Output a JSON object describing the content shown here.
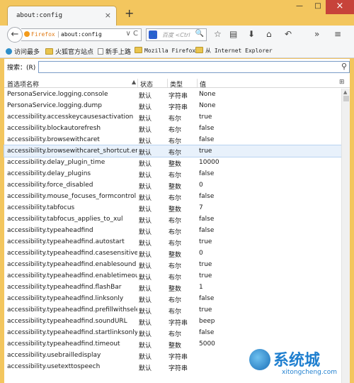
{
  "tab": {
    "title": "about:config",
    "close": "×"
  },
  "newtab": "+",
  "window": {
    "minimize": "—",
    "maximize": "□",
    "close": "×"
  },
  "nav": {
    "identity": "Firefox",
    "url": "about:config",
    "search_placeholder": "百度 <Ctrl",
    "search_engine_glyph": "",
    "url_buttons": "∨ C",
    "search_go": "🔍",
    "icons": {
      "bookmark": "☆",
      "bookmarks_menu": "▤",
      "downloads": "⬇",
      "home": "⌂",
      "reader": "↶",
      "overflow": "»",
      "menu": "≡"
    }
  },
  "bookmarks": [
    {
      "label": "访问最多",
      "icon": "gear"
    },
    {
      "label": "火狐官方站点",
      "icon": "folder"
    },
    {
      "label": "新手上路",
      "icon": "page"
    },
    {
      "label": "Mozilla Firefox",
      "icon": "folder"
    },
    {
      "label": "从 Internet Explorer",
      "icon": "folder"
    }
  ],
  "filter": {
    "label": "搜索：(R)",
    "value": ""
  },
  "columns": {
    "name": "首选项名称",
    "status": "状态",
    "type": "类型",
    "value": "值"
  },
  "column_picker_glyph": "⊞",
  "rows": [
    {
      "name": "PersonaService.logging.console",
      "status": "默认",
      "type": "字符串",
      "value": "None"
    },
    {
      "name": "PersonaService.logging.dump",
      "status": "默认",
      "type": "字符串",
      "value": "None"
    },
    {
      "name": "accessibility.accesskeycausesactivation",
      "status": "默认",
      "type": "布尔",
      "value": "true"
    },
    {
      "name": "accessibility.blockautorefresh",
      "status": "默认",
      "type": "布尔",
      "value": "false"
    },
    {
      "name": "accessibility.browsewithcaret",
      "status": "默认",
      "type": "布尔",
      "value": "false"
    },
    {
      "name": "accessibility.browsewithcaret_shortcut.en...",
      "status": "默认",
      "type": "布尔",
      "value": "true",
      "selected": true
    },
    {
      "name": "accessibility.delay_plugin_time",
      "status": "默认",
      "type": "整数",
      "value": "10000"
    },
    {
      "name": "accessibility.delay_plugins",
      "status": "默认",
      "type": "布尔",
      "value": "false"
    },
    {
      "name": "accessibility.force_disabled",
      "status": "默认",
      "type": "整数",
      "value": "0"
    },
    {
      "name": "accessibility.mouse_focuses_formcontrol",
      "status": "默认",
      "type": "布尔",
      "value": "false"
    },
    {
      "name": "accessibility.tabfocus",
      "status": "默认",
      "type": "整数",
      "value": "7"
    },
    {
      "name": "accessibility.tabfocus_applies_to_xul",
      "status": "默认",
      "type": "布尔",
      "value": "false"
    },
    {
      "name": "accessibility.typeaheadfind",
      "status": "默认",
      "type": "布尔",
      "value": "false"
    },
    {
      "name": "accessibility.typeaheadfind.autostart",
      "status": "默认",
      "type": "布尔",
      "value": "true"
    },
    {
      "name": "accessibility.typeaheadfind.casesensitive",
      "status": "默认",
      "type": "整数",
      "value": "0"
    },
    {
      "name": "accessibility.typeaheadfind.enablesound",
      "status": "默认",
      "type": "布尔",
      "value": "true"
    },
    {
      "name": "accessibility.typeaheadfind.enabletimeout",
      "status": "默认",
      "type": "布尔",
      "value": "true"
    },
    {
      "name": "accessibility.typeaheadfind.flashBar",
      "status": "默认",
      "type": "整数",
      "value": "1"
    },
    {
      "name": "accessibility.typeaheadfind.linksonly",
      "status": "默认",
      "type": "布尔",
      "value": "false"
    },
    {
      "name": "accessibility.typeaheadfind.prefillwithsele...",
      "status": "默认",
      "type": "布尔",
      "value": "true"
    },
    {
      "name": "accessibility.typeaheadfind.soundURL",
      "status": "默认",
      "type": "字符串",
      "value": "beep"
    },
    {
      "name": "accessibility.typeaheadfind.startlinksonly",
      "status": "默认",
      "type": "布尔",
      "value": "false"
    },
    {
      "name": "accessibility.typeaheadfind.timeout",
      "status": "默认",
      "type": "整数",
      "value": "5000"
    },
    {
      "name": "accessibility.usebrailledisplay",
      "status": "默认",
      "type": "字符串",
      "value": ""
    },
    {
      "name": "accessibility.usetexttospeech",
      "status": "默认",
      "type": "字符串",
      "value": ""
    }
  ],
  "watermark": {
    "text": "系统城",
    "url": "xitongcheng.com"
  }
}
